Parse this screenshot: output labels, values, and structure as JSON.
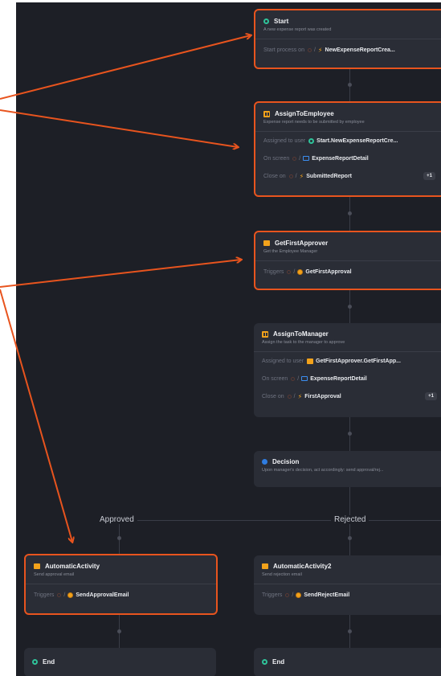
{
  "nodes": {
    "start": {
      "title": "Start",
      "desc": "A new expense report was created",
      "prop_label": "Start process on",
      "prop_value": "NewExpenseReportCrea..."
    },
    "assign_employee": {
      "title": "AssignToEmployee",
      "desc": "Expense report needs to be submitted by employee",
      "assigned_label": "Assigned to user",
      "assigned_value": "Start.NewExpenseReportCre...",
      "screen_label": "On screen",
      "screen_value": "ExpenseReportDetail",
      "close_label": "Close on",
      "close_value": "SubmittedReport",
      "badge": "+1"
    },
    "get_first_approver": {
      "title": "GetFirstApprover",
      "desc": "Get the Employee Manager",
      "triggers_label": "Triggers",
      "triggers_value": "GetFirstApproval"
    },
    "assign_manager": {
      "title": "AssignToManager",
      "desc": "Assign the task to the manager to approve",
      "assigned_label": "Assigned to user",
      "assigned_value": "GetFirstApprover.GetFirstApp...",
      "screen_label": "On screen",
      "screen_value": "ExpenseReportDetail",
      "close_label": "Close on",
      "close_value": "FirstApproval",
      "badge": "+1"
    },
    "decision": {
      "title": "Decision",
      "desc": "Upon manager's decision, act accordingly: send approval/rej..."
    },
    "auto1": {
      "title": "AutomaticActivity",
      "desc": "Send approval email",
      "triggers_label": "Triggers",
      "triggers_value": "SendApprovalEmail"
    },
    "auto2": {
      "title": "AutomaticActivity2",
      "desc": "Send rejection email",
      "triggers_label": "Triggers",
      "triggers_value": "SendRejectEmail"
    },
    "end1": {
      "title": "End"
    },
    "end2": {
      "title": "End"
    }
  },
  "branches": {
    "approved": "Approved",
    "rejected": "Rejected"
  },
  "colors": {
    "canvas": "#1d1f26",
    "node": "#2a2d36",
    "highlight": "#e8541e",
    "start_green": "#2fc39a",
    "activity_orange": "#f2a21b",
    "decision_blue": "#2f7de1"
  }
}
